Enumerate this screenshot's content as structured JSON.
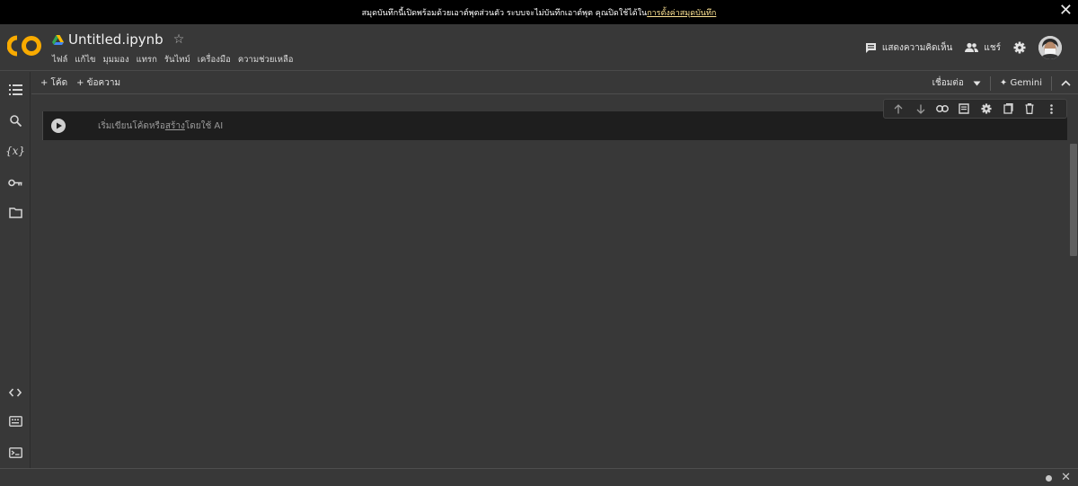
{
  "banner": {
    "text": "สมุดบันทึกนี้เปิดพร้อมด้วยเอาต์พุตส่วนตัว ระบบจะไม่บันทึกเอาต์พุต คุณปิดใช้ได้ใน",
    "link": "การตั้งค่าสมุดบันทึก",
    "close": "✕"
  },
  "header": {
    "logo_text": "CO",
    "title": "Untitled.ipynb",
    "star": "☆",
    "menu": [
      "ไฟล์",
      "แก้ไข",
      "มุมมอง",
      "แทรก",
      "รันไทม์",
      "เครื่องมือ",
      "ความช่วยเหลือ"
    ],
    "comments_label": "แสดงความคิดเห็น",
    "share_label": "แชร์"
  },
  "toolbar": {
    "add_code": "+ โค้ด",
    "add_text": "+ ข้อความ",
    "connect": "เชื่อมต่อ",
    "gemini": "✦ Gemini"
  },
  "cell": {
    "placeholder_prefix": "เริ่มเขียนโค้ดหรือ",
    "placeholder_link": "สร้าง",
    "placeholder_suffix": "โดยใช้ AI"
  },
  "sidebar_icons": [
    "toc-icon",
    "search-icon",
    "variables-icon",
    "secrets-key-icon",
    "files-folder-icon",
    "code-snippets-icon",
    "command-palette-icon",
    "terminal-icon"
  ],
  "cell_toolbar_icons": [
    "move-up-icon",
    "move-down-icon",
    "link-icon",
    "comment-icon",
    "settings-icon",
    "mirror-cell-icon",
    "delete-icon",
    "more-icon"
  ],
  "status": {
    "close": "✕"
  },
  "colors": {
    "background": "#383838",
    "cell": "#1e1e1e",
    "banner": "#000000",
    "banner_link": "#fde293",
    "logo_orange": "#f9ab00"
  }
}
